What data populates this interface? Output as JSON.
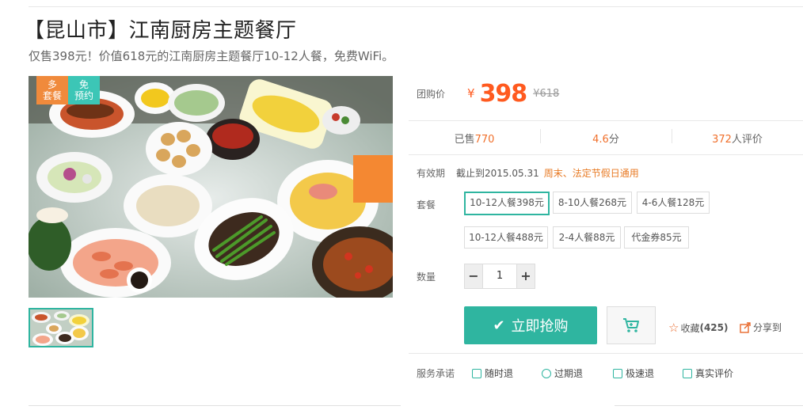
{
  "deal": {
    "title": "【昆山市】江南厨房主题餐厅",
    "subtitle": "仅售398元！价值618元的江南厨房主题餐厅10-12人餐，免费WiFi。",
    "badges": [
      {
        "line1": "多",
        "line2": "套餐",
        "color": "#f08a3c"
      },
      {
        "line1": "免",
        "line2": "预约",
        "color": "#3cc6b6"
      }
    ]
  },
  "price": {
    "label": "团购价",
    "currency": "¥",
    "value": "398",
    "original": "¥618"
  },
  "stats": {
    "sold_prefix": "已售",
    "sold_count": "770",
    "rating": "4.6",
    "rating_unit": "分",
    "reviews": "372",
    "reviews_suffix": "人评价"
  },
  "validity": {
    "label": "有效期",
    "date": "截止到2015.05.31",
    "note": "周末、法定节假日通用"
  },
  "packages": {
    "label": "套餐",
    "options": [
      "10-12人餐398元",
      "8-10人餐268元",
      "4-6人餐128元",
      "10-12人餐488元",
      "2-4人餐88元",
      "代金券85元"
    ],
    "selected": "10-12人餐398元"
  },
  "quantity": {
    "label": "数量",
    "minus": "−",
    "value": "1",
    "plus": "+"
  },
  "actions": {
    "buy_label": "立即抢购",
    "favorite_label": "收藏",
    "favorite_count": "(425)",
    "share_label": "分享到"
  },
  "service": {
    "label": "服务承诺",
    "items": [
      "随时退",
      "过期退",
      "极速退",
      "真实评价"
    ]
  },
  "colors": {
    "accent": "#2fb5a0",
    "price": "#ff5a1f",
    "note": "#e87a24"
  }
}
